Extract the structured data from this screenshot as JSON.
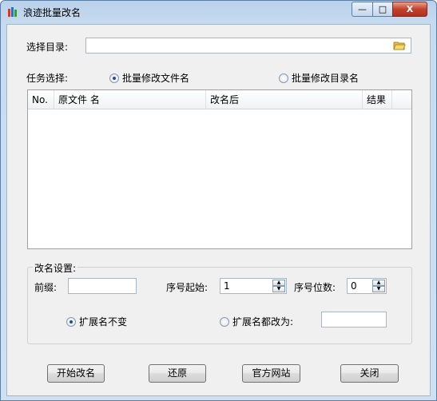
{
  "window": {
    "title": "浪迹批量改名"
  },
  "titlebar_buttons": {
    "minimize": "—",
    "maximize": "□",
    "close": "X"
  },
  "directory": {
    "label": "选择目录:",
    "value": "",
    "folder_icon": "folder-open-icon"
  },
  "task": {
    "label": "任务选择:",
    "options": [
      {
        "label": "批量修改文件名",
        "selected": true
      },
      {
        "label": "批量修改目录名",
        "selected": false
      }
    ]
  },
  "table": {
    "columns": [
      "No.",
      "原文件 名",
      "改名后",
      "结果"
    ],
    "rows": []
  },
  "rename_settings": {
    "title": "改名设置:",
    "prefix_label": "前缀:",
    "prefix_value": "",
    "seq_start_label": "序号起始:",
    "seq_start_value": "1",
    "seq_digits_label": "序号位数:",
    "seq_digits_value": "0",
    "ext_keep_label": "扩展名不变",
    "ext_keep_selected": true,
    "ext_change_label": "扩展名都改为:",
    "ext_change_selected": false,
    "ext_change_value": ""
  },
  "buttons": {
    "start": "开始改名",
    "restore": "还原",
    "website": "官方网站",
    "close": "关闭"
  },
  "colors": {
    "accent": "#1d4f91",
    "close_button": "#c4402a"
  }
}
